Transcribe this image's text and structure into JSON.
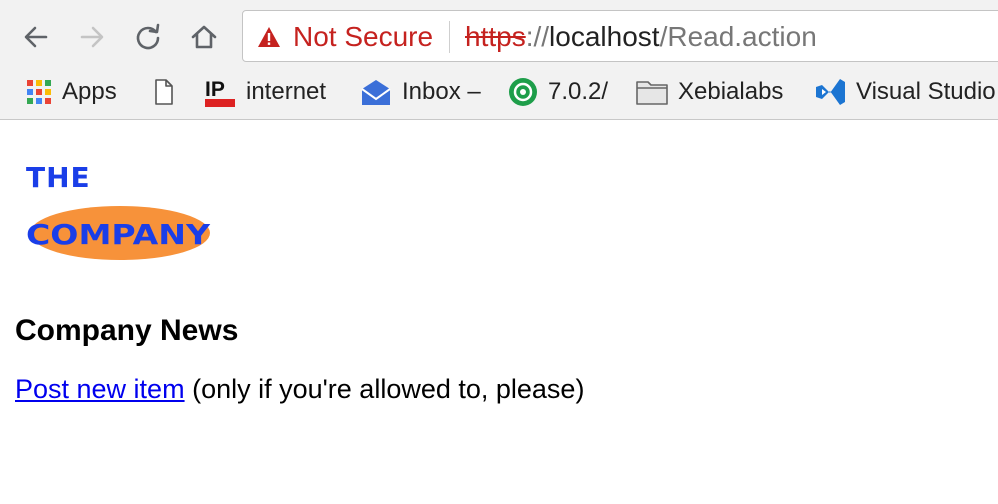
{
  "toolbar": {
    "back_icon": "arrow-left-icon",
    "forward_icon": "arrow-right-icon",
    "reload_icon": "reload-icon",
    "home_icon": "home-icon"
  },
  "address_bar": {
    "security_label": "Not Secure",
    "url_scheme": "https",
    "url_separator": "://",
    "url_host": "localhost",
    "url_path": "/Read.action",
    "warning_color": "#c5221f"
  },
  "bookmarks": [
    {
      "label": "Apps",
      "icon": "apps-grid-icon"
    },
    {
      "label": "",
      "icon": "page-icon"
    },
    {
      "label": "internet",
      "icon": "ip-logo-icon"
    },
    {
      "label": "Inbox –",
      "icon": "inbox-icon"
    },
    {
      "label": "7.0.2/",
      "icon": "green-circle-icon"
    },
    {
      "label": "Xebialabs",
      "icon": "folder-icon"
    },
    {
      "label": "Visual Studio",
      "icon": "visual-studio-icon"
    }
  ],
  "page": {
    "logo_top": "THE",
    "logo_bottom": "COMPANY",
    "heading": "Company News",
    "post_link": "Post new item",
    "post_note": " (only if you're allowed to, please)"
  },
  "colors": {
    "link": "#0000ee",
    "logo_text": "#1a3ee8",
    "logo_ellipse": "#f7923a"
  }
}
